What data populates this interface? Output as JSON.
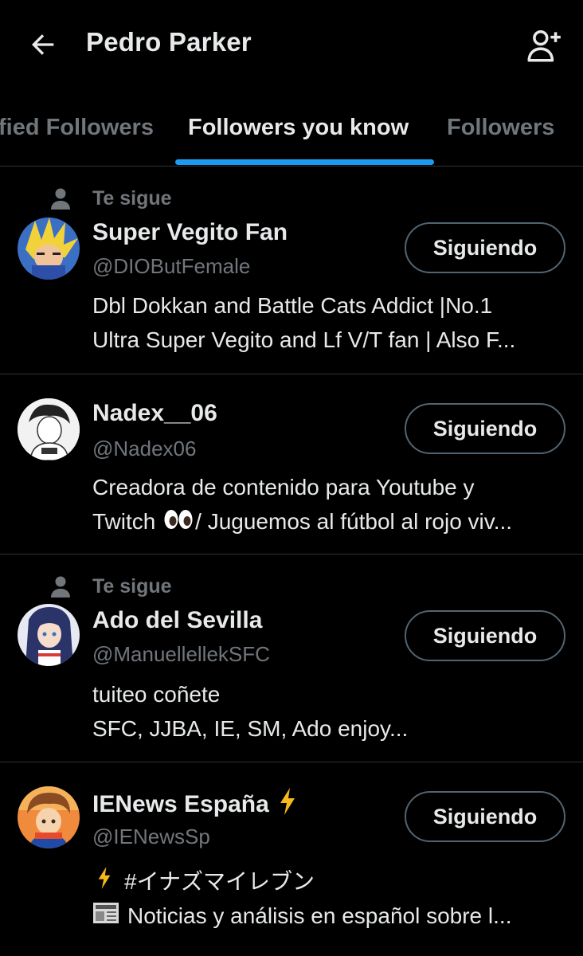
{
  "header": {
    "title": "Pedro Parker"
  },
  "tabs": [
    {
      "label": "Verified Followers",
      "visible_text": "fied Followers",
      "active": false
    },
    {
      "label": "Followers you know",
      "active": true
    },
    {
      "label": "Followers",
      "active": false
    }
  ],
  "users": [
    {
      "social_context": "Te sigue",
      "name": "Super Vegito Fan",
      "handle": "@DIOButFemale",
      "bio_line1": "Dbl Dokkan and Battle Cats Addict |No.1",
      "bio_line2": "Ultra Super Vegito and Lf V/T fan | Also F...",
      "button_label": "Siguiendo"
    },
    {
      "social_context": "",
      "name": "Nadex__06",
      "handle": "@Nadex06",
      "bio_line1": "Creadora de contenido para Youtube y",
      "bio_line2_before": "Twitch ",
      "bio_line2_after": "/ Juguemos al fútbol al rojo viv...",
      "bio_line2_emoji": "eyes-emoji",
      "button_label": "Siguiendo"
    },
    {
      "social_context": "Te sigue",
      "name": "Ado del Sevilla",
      "handle": "@ManuellellekSFC",
      "bio_line1": "tuiteo coñete",
      "bio_line2": "SFC, JJBA, IE, SM, Ado enjoy...",
      "button_label": "Siguiendo"
    },
    {
      "social_context": "",
      "name": "IENews España",
      "name_emoji": "lightning-icon",
      "handle": "@IENewsSp",
      "bio_line1": "#イナズマイレブン",
      "bio_line1_emoji": "lightning-icon",
      "bio_line2": "Noticias y análisis en español sobre l...",
      "bio_line2_emoji": "newspaper-icon",
      "button_label": "Siguiendo"
    }
  ],
  "colors": {
    "background": "#000000",
    "text_primary": "#e7e9ea",
    "text_secondary": "#71767b",
    "accent": "#1d9bf0",
    "divider": "#2f3336",
    "button_border": "#536471"
  },
  "icons": {
    "back": "arrow-left-icon",
    "add_user": "add-user-icon",
    "social_context": "person-icon"
  }
}
